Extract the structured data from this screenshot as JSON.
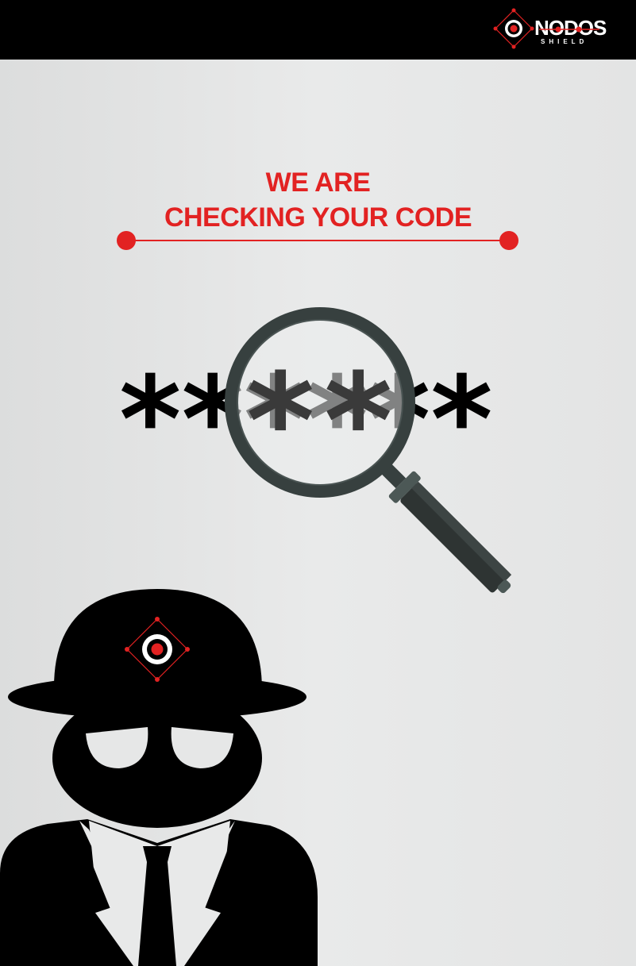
{
  "brand": {
    "name": "NODOS",
    "sub": "SHIELD"
  },
  "headline": {
    "line1": "WE ARE",
    "line2": "CHECKING YOUR CODE"
  },
  "code_mask": "******",
  "colors": {
    "accent": "#e22222",
    "topbar": "#000000",
    "figure": "#000000",
    "magnifier_frame": "#37403f"
  },
  "icons": [
    "nodos-logo-icon",
    "magnifying-glass-icon",
    "spy-figure-icon",
    "target-emblem-icon"
  ]
}
